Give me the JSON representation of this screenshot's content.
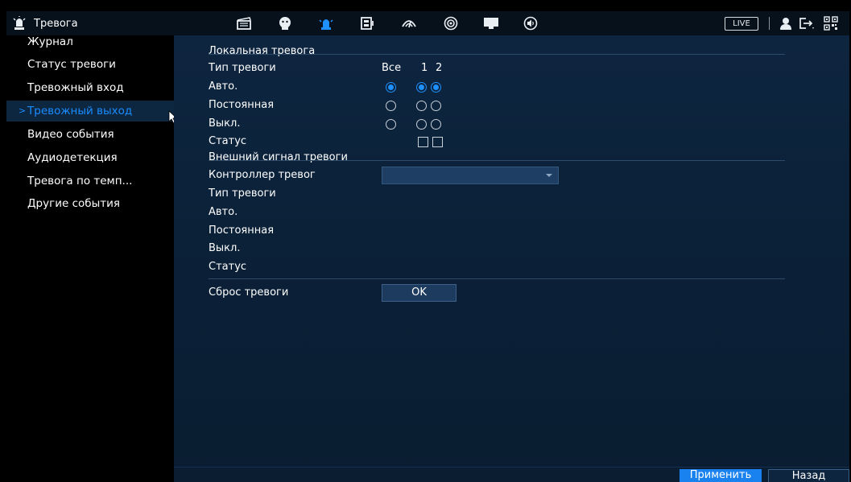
{
  "topbar": {
    "title": "Тревога",
    "title_icon": "alarm-light-icon",
    "icons": [
      "film-icon",
      "face-icon",
      "alarm-light-icon",
      "storage-icon",
      "network-icon",
      "camera-icon",
      "display-icon",
      "audio-icon"
    ],
    "live_label": "LIVE",
    "right_icons": [
      "user-icon",
      "logout-icon",
      "qr-code-icon"
    ]
  },
  "sidebar": {
    "items": [
      {
        "label": "Журнал"
      },
      {
        "label": "Статус тревоги"
      },
      {
        "label": "Тревожный вход"
      },
      {
        "label": "Тревожный выход",
        "active": true
      },
      {
        "label": "Видео события"
      },
      {
        "label": "Аудиодетекция"
      },
      {
        "label": "Тревога по темп..."
      },
      {
        "label": "Другие события"
      }
    ],
    "active_chevron": ">"
  },
  "main": {
    "local_section": "Локальная тревога",
    "type_label": "Тип тревоги",
    "col_all": "Все",
    "col_1": "1",
    "col_2": "2",
    "rows": [
      {
        "label": "Авто.",
        "all": true,
        "ch1": true,
        "ch2": true
      },
      {
        "label": "Постоянная",
        "all": false,
        "ch1": false,
        "ch2": false
      },
      {
        "label": "Выкл.",
        "all": false,
        "ch1": false,
        "ch2": false
      }
    ],
    "status_label": "Статус",
    "external_section": "Внешний сигнал тревоги",
    "controller_label": "Контроллер тревог",
    "controller_value": "",
    "ext_type_label": "Тип тревоги",
    "ext_auto_label": "Авто.",
    "ext_const_label": "Постоянная",
    "ext_off_label": "Выкл.",
    "ext_status_label": "Статус",
    "reset_label": "Сброс тревоги",
    "ok_label": "OK"
  },
  "footer": {
    "apply_label": "Применить",
    "back_label": "Назад"
  },
  "colors": {
    "accent": "#1a82ee",
    "panel_bg": "#0b2138",
    "active_text": "#1a8cff"
  }
}
